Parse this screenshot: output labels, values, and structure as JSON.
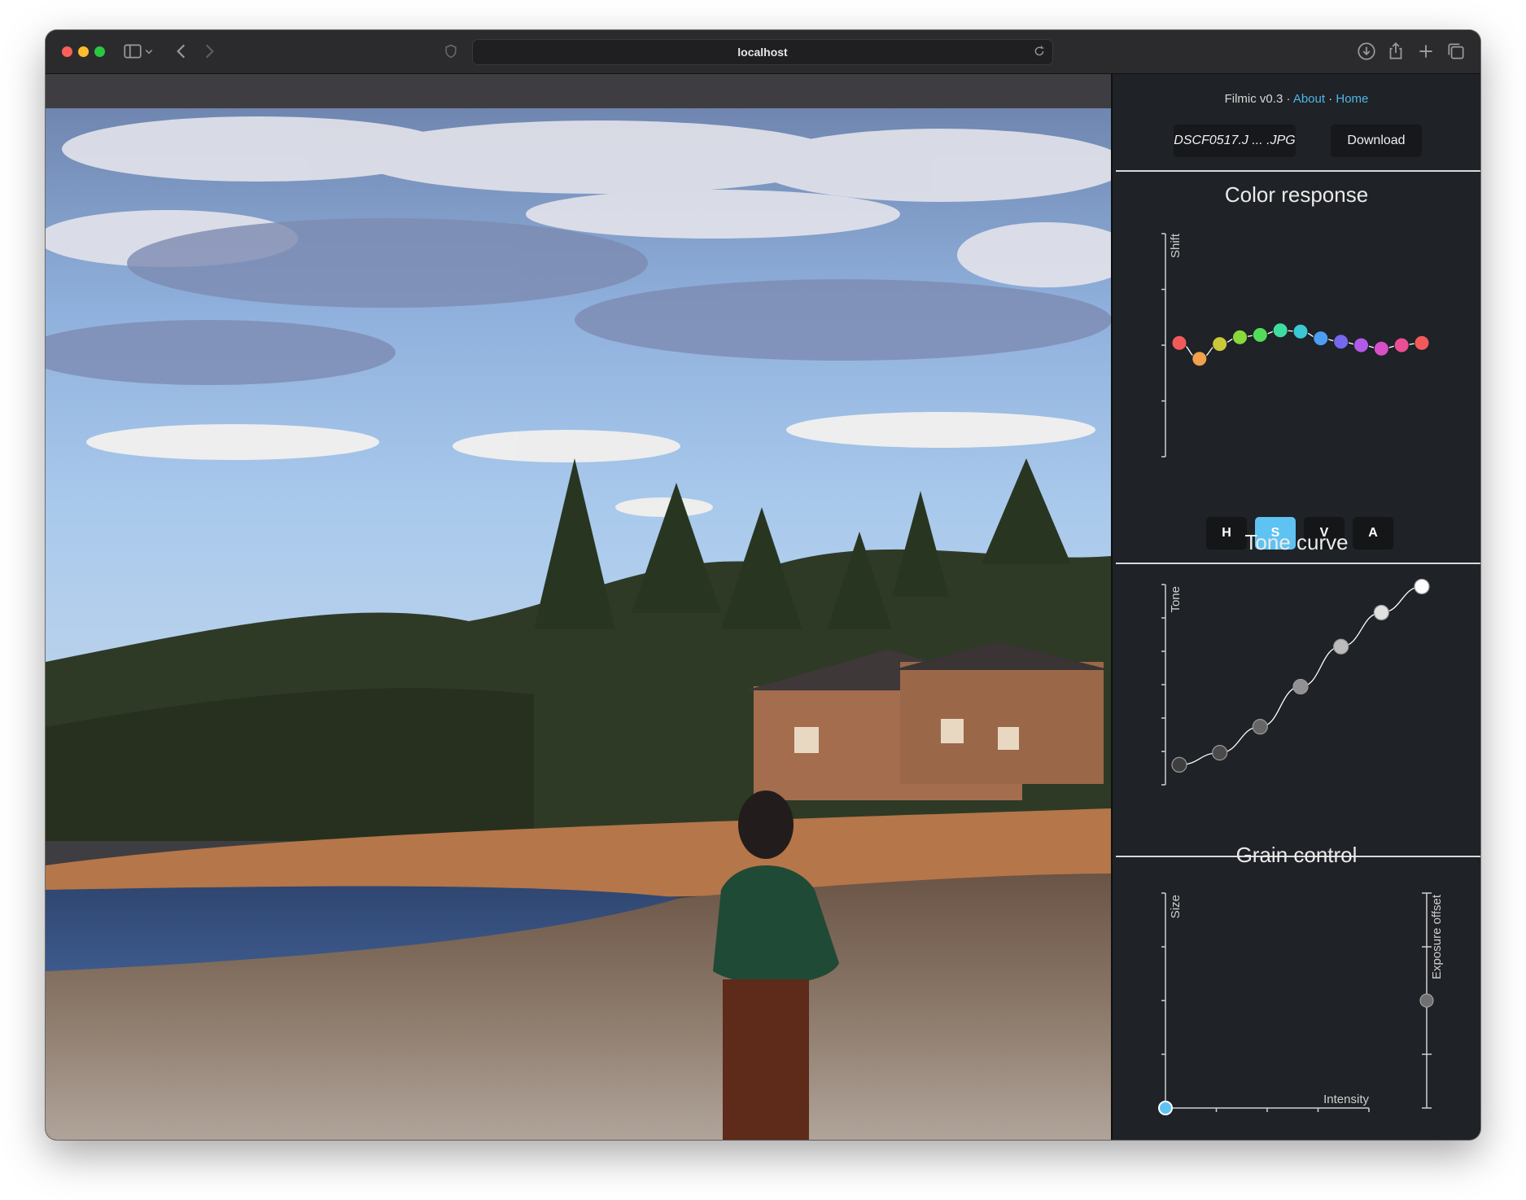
{
  "browser": {
    "url": "localhost",
    "toolbar_icons": [
      "sidebar-icon",
      "chevron-down-icon",
      "back-icon",
      "forward-icon",
      "shield-icon",
      "reload-icon",
      "download-icon",
      "share-icon",
      "plus-icon",
      "tabs-icon"
    ]
  },
  "app": {
    "version_label": "Filmic v0.3",
    "separator": "·",
    "about_link": "About",
    "home_link": "Home",
    "file_button": "DSCF0517.J ... .JPG",
    "download_button": "Download"
  },
  "color_response": {
    "title": "Color response",
    "y_axis_label": "Shift",
    "tabs": [
      {
        "label": "H",
        "active": false
      },
      {
        "label": "S",
        "active": true
      },
      {
        "label": "V",
        "active": false
      },
      {
        "label": "A",
        "active": false
      }
    ],
    "points": [
      {
        "color": "#f25a5a",
        "shift": 0.02
      },
      {
        "color": "#f2a04a",
        "shift": -0.12
      },
      {
        "color": "#c8c83a",
        "shift": 0.01
      },
      {
        "color": "#8ad83c",
        "shift": 0.07
      },
      {
        "color": "#52dc5a",
        "shift": 0.09
      },
      {
        "color": "#3fdca0",
        "shift": 0.13
      },
      {
        "color": "#3ac8d2",
        "shift": 0.12
      },
      {
        "color": "#4c9ef0",
        "shift": 0.06
      },
      {
        "color": "#7468ee",
        "shift": 0.03
      },
      {
        "color": "#b25ae8",
        "shift": 0.0
      },
      {
        "color": "#d84fc8",
        "shift": -0.03
      },
      {
        "color": "#ea4f96",
        "shift": 0.0
      },
      {
        "color": "#f25a5a",
        "shift": 0.02
      }
    ]
  },
  "tone_curve": {
    "title": "Tone curve",
    "y_axis_label": "Tone",
    "points": [
      {
        "x": 0.0,
        "y": 0.1
      },
      {
        "x": 0.1667,
        "y": 0.16
      },
      {
        "x": 0.3333,
        "y": 0.29
      },
      {
        "x": 0.5,
        "y": 0.49
      },
      {
        "x": 0.6667,
        "y": 0.69
      },
      {
        "x": 0.8333,
        "y": 0.86
      },
      {
        "x": 1.0,
        "y": 0.99
      }
    ]
  },
  "grain_control": {
    "title": "Grain control",
    "y_axis_label": "Size",
    "x_axis_label": "Intensity",
    "exposure_label": "Exposure offset",
    "size_intensity_point": {
      "intensity": 0.0,
      "size": 0.0
    },
    "exposure_offset": 0.5
  },
  "colors": {
    "accent": "#5ec2f2",
    "link": "#4fb6e8",
    "panel_bg": "#1f2226"
  }
}
